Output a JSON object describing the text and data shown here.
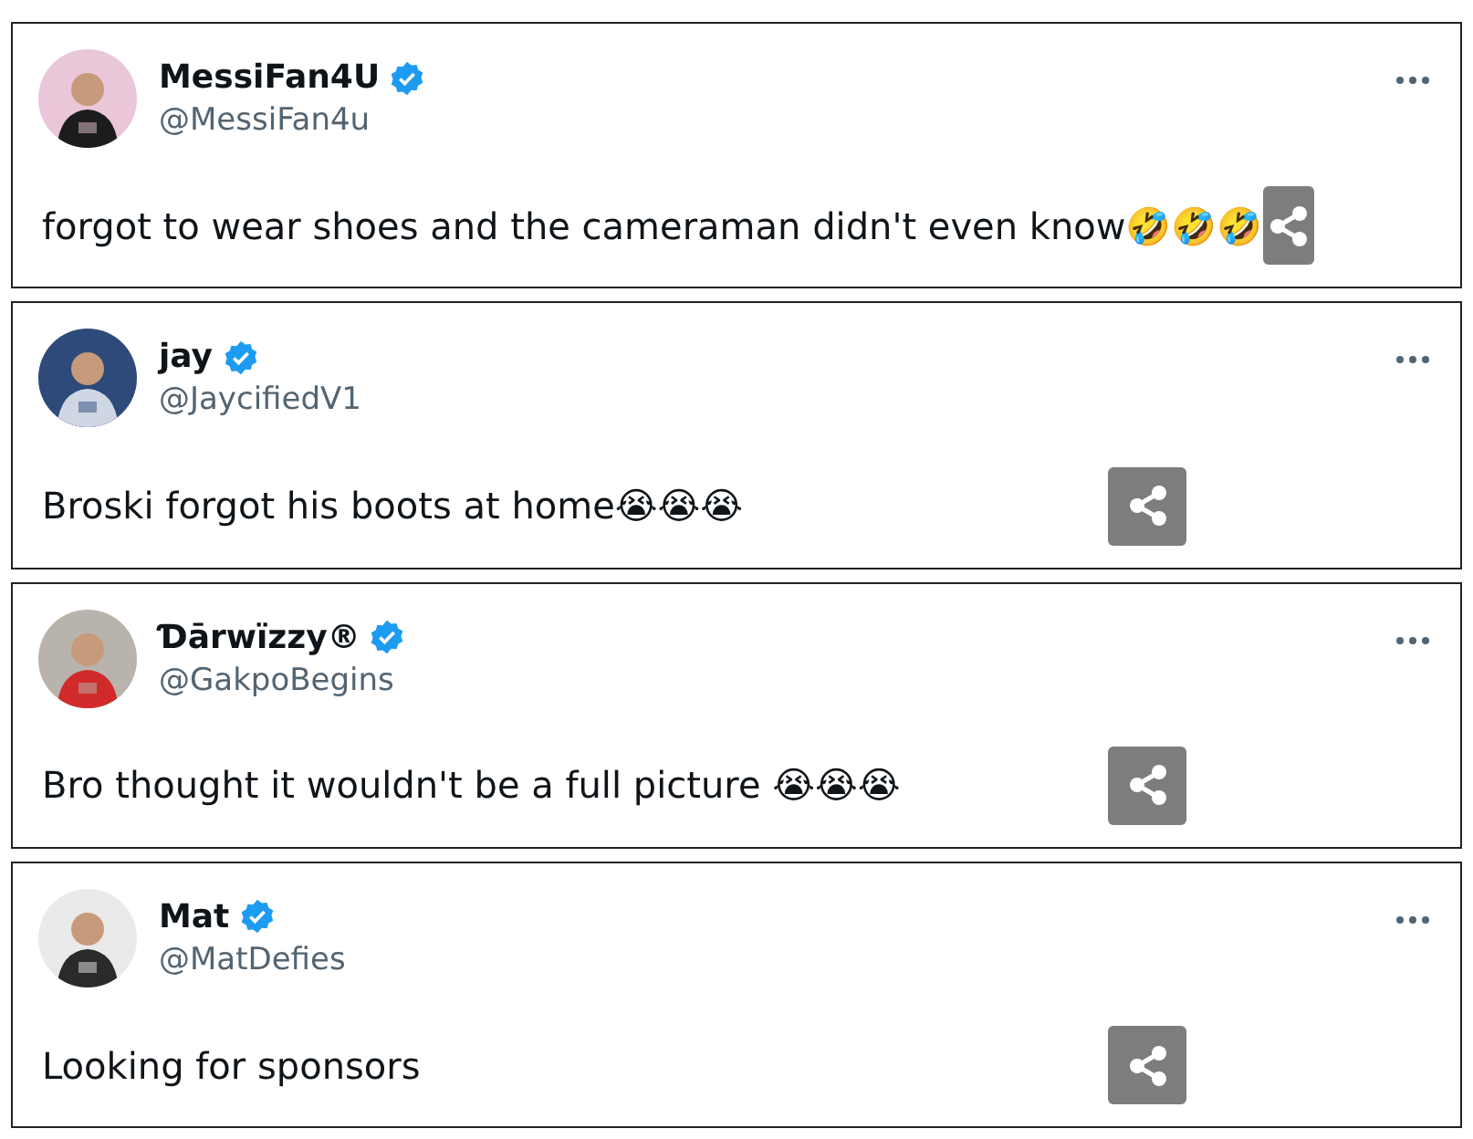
{
  "posts": [
    {
      "name": "MessiFan4U",
      "verified": true,
      "handle": "@MessiFan4u",
      "text": "forgot to wear shoes and the cameraman didn't even know🤣🤣🤣"
    },
    {
      "name": "jay",
      "verified": true,
      "handle": "@JaycifiedV1",
      "text": "Broski forgot his boots at home😭😭😭"
    },
    {
      "name": "Ɗārwïzzy®",
      "verified": true,
      "handle": "@GakpoBegins",
      "text": "Bro thought it wouldn't be a full picture 😭😭😭"
    },
    {
      "name": "Mat",
      "verified": true,
      "handle": "@MatDefies",
      "text": "Looking for sponsors"
    }
  ]
}
